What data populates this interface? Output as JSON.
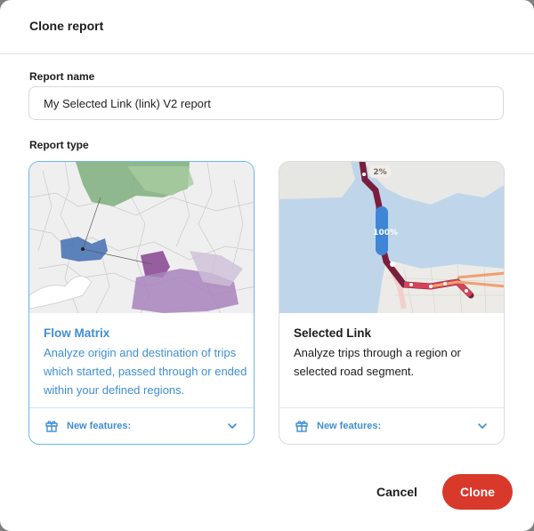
{
  "dialog": {
    "title": "Clone report",
    "report_name_label": "Report name",
    "report_name_value": "My Selected Link (link) V2 report",
    "report_type_label": "Report type"
  },
  "report_types": [
    {
      "title": "Flow Matrix",
      "description": "Analyze origin and destination of trips which started, passed through or ended within your defined regions.",
      "features_label": "New features:",
      "selected": true
    },
    {
      "title": "Selected Link",
      "description": "Analyze trips through a region or selected road segment.",
      "features_label": "New features:",
      "selected": false
    }
  ],
  "map_labels": {
    "top_percent": "2%",
    "link_percent": "100%"
  },
  "icons": [
    "gift-icon",
    "chevron-down-icon"
  ],
  "buttons": {
    "cancel": "Cancel",
    "clone": "Clone"
  },
  "colors": {
    "accent": "#3f8fd2",
    "selected_border": "#6db9e8",
    "clone_button": "#d8392b"
  }
}
